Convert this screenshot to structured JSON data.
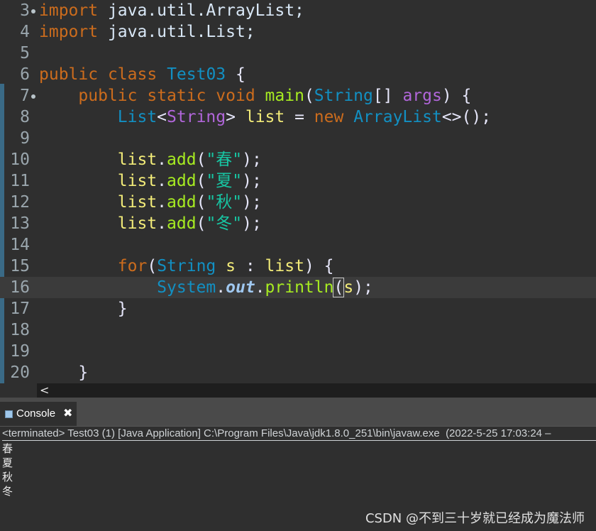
{
  "editor": {
    "lines": {
      "l3": {
        "num": "3",
        "kw": "import",
        "rest": " java.util.ArrayList;"
      },
      "l4": {
        "num": "4",
        "kw": "import",
        "rest": " java.util.List;"
      },
      "l5": {
        "num": "5"
      },
      "l6": {
        "num": "6",
        "kw1": "public",
        "kw2": "class",
        "cls": "Test03",
        "rest": " {"
      },
      "l7": {
        "num": "7",
        "kw1": "public",
        "kw2": "static",
        "kw3": "void",
        "method": "main",
        "p1": "(",
        "type": "String",
        "p2": "[] ",
        "param": "args",
        "p3": ") {"
      },
      "l8": {
        "num": "8",
        "type1": "List",
        "lt": "<",
        "targ": "String",
        "gt": ">",
        "var": "list",
        "eq": " = ",
        "kw": "new",
        "type2": "ArrayList",
        "rest": "<>();"
      },
      "l9": {
        "num": "9"
      },
      "l10": {
        "num": "10",
        "obj": "list",
        "dot": ".",
        "method": "add",
        "p1": "(",
        "str": "\"春\"",
        "p2": ");"
      },
      "l11": {
        "num": "11",
        "obj": "list",
        "dot": ".",
        "method": "add",
        "p1": "(",
        "str": "\"夏\"",
        "p2": ");"
      },
      "l12": {
        "num": "12",
        "obj": "list",
        "dot": ".",
        "method": "add",
        "p1": "(",
        "str": "\"秋\"",
        "p2": ");"
      },
      "l13": {
        "num": "13",
        "obj": "list",
        "dot": ".",
        "method": "add",
        "p1": "(",
        "str": "\"冬\"",
        "p2": ");"
      },
      "l14": {
        "num": "14"
      },
      "l15": {
        "num": "15",
        "kw": "for",
        "p1": "(",
        "type": "String",
        "var": "s",
        "colon": " : ",
        "obj": "list",
        "p2": ") {"
      },
      "l16": {
        "num": "16",
        "type": "System",
        "dot1": ".",
        "field": "out",
        "dot2": ".",
        "method": "println",
        "p1": "(",
        "arg": "s",
        "p2": ");"
      },
      "l17": {
        "num": "17",
        "brace": "}"
      },
      "l18": {
        "num": "18"
      },
      "l19": {
        "num": "19"
      },
      "l20": {
        "num": "20",
        "brace": "}"
      }
    },
    "hscroll_arrow": "<"
  },
  "console": {
    "tab_label": "Console",
    "close_glyph": "✖",
    "status": "<terminated> Test03 (1) [Java Application] C:\\Program Files\\Java\\jdk1.8.0_251\\bin\\javaw.exe  (2022-5-25 17:03:24 –",
    "output": [
      "春",
      "夏",
      "秋",
      "冬"
    ]
  },
  "watermark": "CSDN @不到三十岁就已经成为魔法师",
  "colors": {
    "background": "#2f2f2f",
    "keyword": "#cc6c1d",
    "type": "#1290c3",
    "method": "#a7ec21",
    "string": "#17c6a3",
    "local_var": "#f3ec79"
  }
}
